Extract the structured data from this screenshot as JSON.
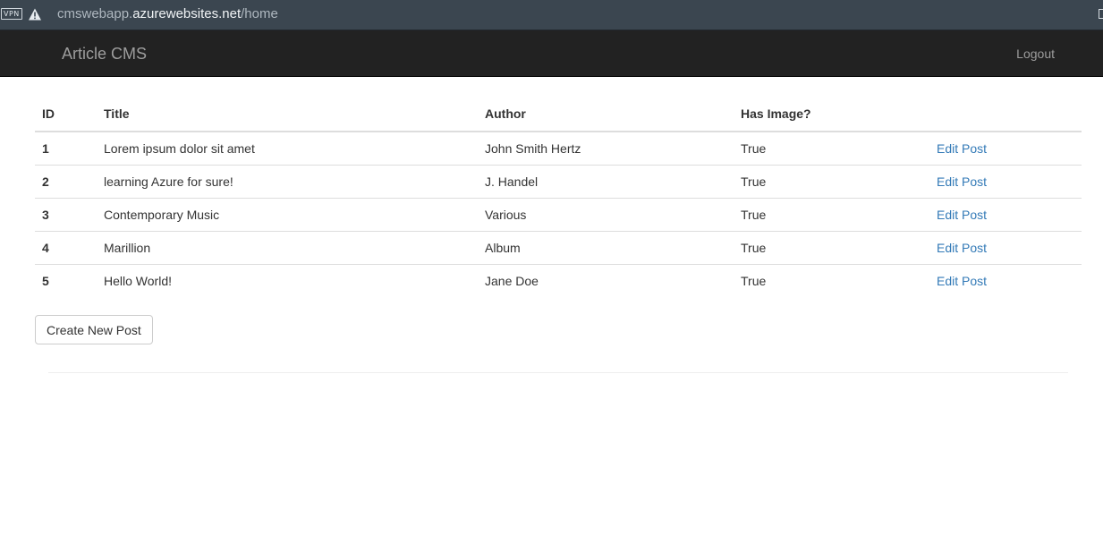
{
  "browser": {
    "vpn_label": "VPN",
    "url_prefix": "cmswebapp.",
    "url_host": "azurewebsites.net",
    "url_path": "/home",
    "icons": [
      "vpn-badge",
      "warning-icon",
      "extension-icon"
    ]
  },
  "navbar": {
    "brand": "Article CMS",
    "logout": "Logout"
  },
  "table": {
    "headers": [
      "ID",
      "Title",
      "Author",
      "Has Image?",
      ""
    ],
    "rows": [
      {
        "id": "1",
        "title": "Lorem ipsum dolor sit amet",
        "author": "John Smith Hertz",
        "has_image": "True",
        "action": "Edit Post"
      },
      {
        "id": "2",
        "title": "learning Azure for sure!",
        "author": "J. Handel",
        "has_image": "True",
        "action": "Edit Post"
      },
      {
        "id": "3",
        "title": "Contemporary Music",
        "author": "Various",
        "has_image": "True",
        "action": "Edit Post"
      },
      {
        "id": "4",
        "title": "Marillion",
        "author": "Album",
        "has_image": "True",
        "action": "Edit Post"
      },
      {
        "id": "5",
        "title": "Hello World!",
        "author": "Jane Doe",
        "has_image": "True",
        "action": "Edit Post"
      }
    ]
  },
  "actions": {
    "create_label": "Create New Post"
  },
  "colors": {
    "navbar_bg": "#222222",
    "navbar_text": "#9d9d9d",
    "link": "#337ab7",
    "address_bar_bg": "#3b4650"
  }
}
